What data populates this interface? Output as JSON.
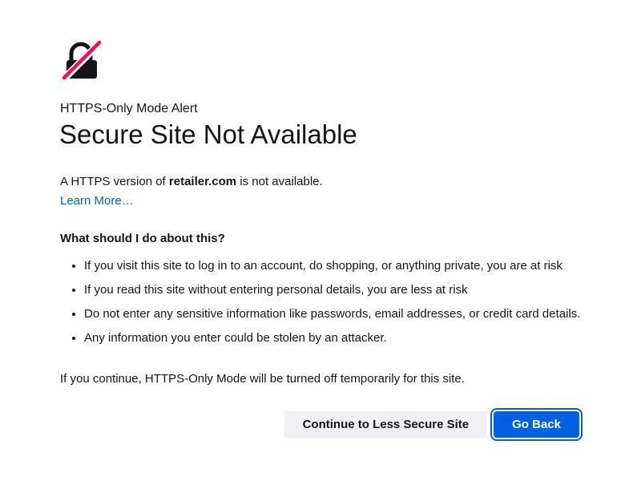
{
  "alert_label": "HTTPS-Only Mode Alert",
  "title": "Secure Site Not Available",
  "intro": {
    "prefix": "A HTTPS version of",
    "domain": "retailer.com",
    "suffix": "is not available."
  },
  "learn_more": "Learn More…",
  "question": "What should I do about this?",
  "advice": [
    "If you visit this site to log in to an account, do shopping, or anything private, you are at risk",
    "If you read this site without entering personal details, you are less at risk",
    "Do not enter any sensitive information like passwords, email addresses, or credit card details.",
    "Any information you enter could be stolen by an attacker."
  ],
  "continue_note": "If you continue, HTTPS-Only Mode will be turned off temporarily for this site.",
  "buttons": {
    "continue_label": "Continue to Less Secure Site",
    "go_back_label": "Go Back"
  },
  "colors": {
    "link": "#0061e0",
    "primary_button": "#0061e0",
    "slash": "#ff0a54",
    "text": "#15141a"
  },
  "icon": "lock-broken-icon"
}
